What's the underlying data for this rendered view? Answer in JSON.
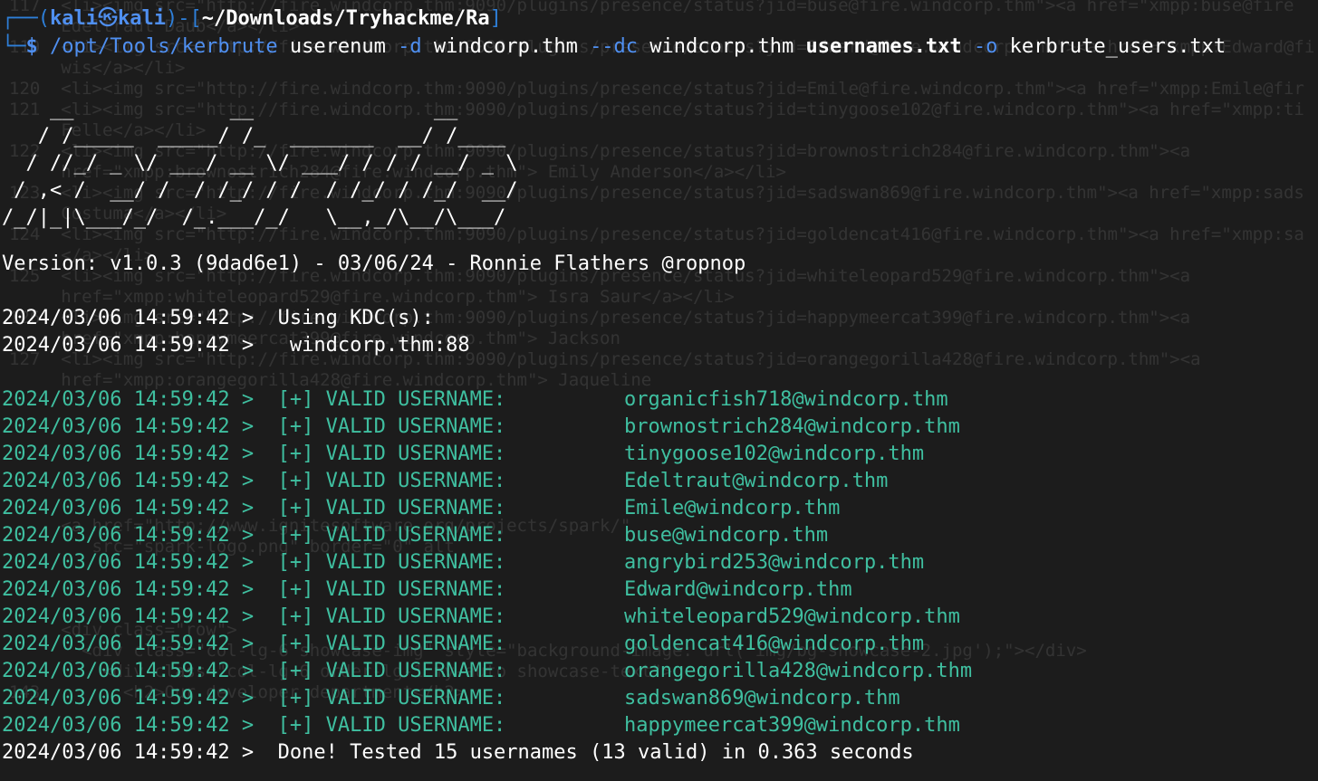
{
  "prompt": {
    "frame_top": "┌──(",
    "user": "kali",
    "icon": "㉿",
    "host": "kali",
    "frame_mid": ")-[",
    "path": "~/Downloads/Tryhackme/Ra",
    "frame_end": "]",
    "frame_bottom": "└─",
    "dollar": "$ "
  },
  "command": {
    "binary": "/opt/Tools/kerbrute",
    "subcommand": " userenum ",
    "flag_d": "-d",
    "domain": " windcorp.thm ",
    "flag_dc": "--dc",
    "dc": " windcorp.thm ",
    "wordlist": "usernames.txt",
    "space": " ",
    "flag_o": "-o",
    "output": " kerbrute_users.txt"
  },
  "banner_lines": [
    "    __             __               __     ",
    "   / /_____  _____/ /_  _______  __/ /____ ",
    "  / //_/ _ \\/ ___/ __ \\/ ___/ / / / __/ _ \\",
    " / ,< /  __/ /  / /_/ / /  / /_/ / /_/  __/",
    "/_/|_|\\___/_/  /_.___/_/   \\__,_/\\__/\\___/ "
  ],
  "version": "Version: v1.0.3 (9dad6e1) - 03/06/24 - Ronnie Flathers @ropnop",
  "kdc_header": {
    "timestamp": "2024/03/06 14:59:42 >",
    "text": "  Using KDC(s):"
  },
  "kdc_entry": {
    "timestamp": "2024/03/06 14:59:42 >",
    "text": "   windcorp.thm:88"
  },
  "valid_label": "  [+] VALID USERNAME:\t",
  "valid_rows": [
    {
      "timestamp": "2024/03/06 14:59:42 >",
      "user": "organicfish718@windcorp.thm"
    },
    {
      "timestamp": "2024/03/06 14:59:42 >",
      "user": "brownostrich284@windcorp.thm"
    },
    {
      "timestamp": "2024/03/06 14:59:42 >",
      "user": "tinygoose102@windcorp.thm"
    },
    {
      "timestamp": "2024/03/06 14:59:42 >",
      "user": "Edeltraut@windcorp.thm"
    },
    {
      "timestamp": "2024/03/06 14:59:42 >",
      "user": "Emile@windcorp.thm"
    },
    {
      "timestamp": "2024/03/06 14:59:42 >",
      "user": "buse@windcorp.thm"
    },
    {
      "timestamp": "2024/03/06 14:59:42 >",
      "user": "angrybird253@windcorp.thm"
    },
    {
      "timestamp": "2024/03/06 14:59:42 >",
      "user": "Edward@windcorp.thm"
    },
    {
      "timestamp": "2024/03/06 14:59:42 >",
      "user": "whiteleopard529@windcorp.thm"
    },
    {
      "timestamp": "2024/03/06 14:59:42 >",
      "user": "goldencat416@windcorp.thm"
    },
    {
      "timestamp": "2024/03/06 14:59:42 >",
      "user": "orangegorilla428@windcorp.thm"
    },
    {
      "timestamp": "2024/03/06 14:59:42 >",
      "user": "sadswan869@windcorp.thm"
    },
    {
      "timestamp": "2024/03/06 14:59:42 >",
      "user": "happymeercat399@windcorp.thm"
    }
  ],
  "done": {
    "timestamp": "2024/03/06 14:59:42 >",
    "text": "  Done! Tested 15 usernames (13 valid) in 0.363 seconds"
  },
  "background_lines": [
    "117  <li><img src=\"http://fire.windcorp.thm:9090/plugins/presence/status?jid=buse@fire.windcorp.thm\"><a href=\"xmpp:buse@fire",
    "     Edeltraut Daub</a></li>",
    "119  <li><img src=\"http://fire.windcorp.thm:9090/plugins/presence/status?jid=Edward@fire.windcorp.thm\"><a href=\"xmpp:Edward@fi",
    "     wis</a></li>",
    "120  <li><img src=\"http://fire.windcorp.thm:9090/plugins/presence/status?jid=Emile@fire.windcorp.thm\"><a href=\"xmpp:Emile@fir",
    "121  <li><img src=\"http://fire.windcorp.thm:9090/plugins/presence/status?jid=tinygoose102@fire.windcorp.thm\"><a href=\"xmpp:ti",
    "     Felle</a></li>",
    "122  <li><img src=\"http://fire.windcorp.thm:9090/plugins/presence/status?jid=brownostrich284@fire.windcorp.thm\"><a",
    "     href=\"xmpp:brownostrich284@fire.windcorp.thm\"> Emily Anderson</a></li>",
    "123  <li><img src=\"http://fire.windcorp.thm:9090/plugins/presence/status?jid=sadswan869@fire.windcorp.thm\"><a href=\"xmpp:sads",
    "     Costuma</a></li>",
    "124  <li><img src=\"http://fire.windcorp.thm:9090/plugins/presence/status?jid=goldencat416@fire.windcorp.thm\"><a href=\"xmpp:sa",
    "     </a></li>",
    "125  <li><img src=\"http://fire.windcorp.thm:9090/plugins/presence/status?jid=whiteleopard529@fire.windcorp.thm\"><a",
    "     href=\"xmpp:whiteleopard529@fire.windcorp.thm\"> Isra Saur</a></li>",
    "126  <li><img src=\"http://fire.windcorp.thm:9090/plugins/presence/status?jid=happymeercat399@fire.windcorp.thm\"><a",
    "     href=\"xmpp:happymeercat399@fire.windcorp.thm\"> Jackson",
    "127  <li><img src=\"http://fire.windcorp.thm:9090/plugins/presence/status?jid=orangegorilla428@fire.windcorp.thm\"><a",
    "     href=\"xmpp:orangegorilla428@fire.windcorp.thm\"> Jaqueline",
    "",
    "",
    "",
    "",
    "",
    "",
    "     <a href=\"http://www.ignitesoftware.org/projects/spark/\"",
    "        src=\"spark-logo.png\" border=\"0\" alt",
    "",
    "",
    "",
    "     <div class=\"row\">",
    "       <div class=\"col-lg-6 showcase-img\" style=\"background-image: url('img/bg-showcase-2.jpg');\"></div>",
    "         <div class=\"col-lg-6 order-lg-1 my-auto showcase-text\">",
    "143        <h2>Our developer department</h2>"
  ],
  "colors": {
    "background": "#1c1c1c",
    "prompt_blue": "#4f8ff0",
    "valid_green": "#3fbfa0",
    "text": "#ffffff"
  }
}
